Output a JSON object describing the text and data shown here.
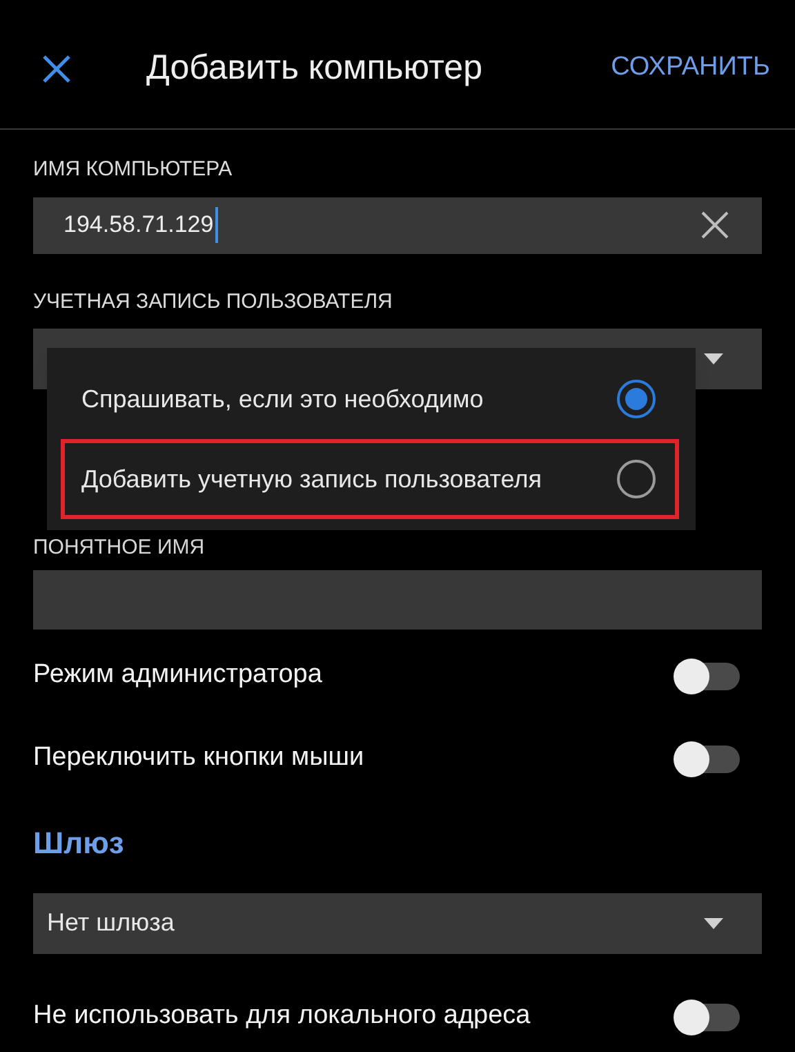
{
  "header": {
    "title": "Добавить компьютер",
    "save": "СОХРАНИТЬ"
  },
  "computer_name": {
    "label": "ИМЯ КОМПЬЮТЕРА",
    "value": "194.58.71.129"
  },
  "user_account": {
    "label": "УЧЕТНАЯ ЗАПИСЬ ПОЛЬЗОВАТЕЛЯ",
    "menu": [
      {
        "label": "Спрашивать, если это необходимо",
        "selected": true,
        "highlighted": false
      },
      {
        "label": "Добавить учетную запись пользователя",
        "selected": false,
        "highlighted": true
      }
    ]
  },
  "friendly_name": {
    "label": "ПОНЯТНОЕ ИМЯ"
  },
  "toggles": [
    {
      "label": "Режим администратора",
      "on": false
    },
    {
      "label": "Переключить кнопки мыши",
      "on": false
    }
  ],
  "gateway": {
    "heading": "Шлюз",
    "value": "Нет шлюза",
    "toggles": [
      {
        "label": "Не использовать для локального адреса",
        "on": false
      }
    ]
  }
}
